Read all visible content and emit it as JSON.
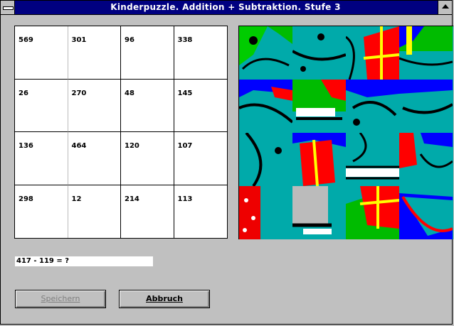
{
  "window": {
    "title": "Kinderpuzzle. Addition + Subtraktion. Stufe  3"
  },
  "grid": {
    "rows": [
      [
        "569",
        "301",
        "96",
        "338"
      ],
      [
        "26",
        "270",
        "48",
        "145"
      ],
      [
        "136",
        "464",
        "120",
        "107"
      ],
      [
        "298",
        "12",
        "214",
        "113"
      ]
    ]
  },
  "question": {
    "text": "417 - 119 = ?"
  },
  "buttons": {
    "save_label": "Speichern",
    "cancel_label": "Abbruch"
  },
  "colors": {
    "title_bar": "#000080",
    "dialog": "#c0c0c0",
    "puzzle_cyan": "#00aaaa",
    "puzzle_red": "#ff0000",
    "puzzle_blue": "#0000ff",
    "puzzle_green": "#00cc00",
    "puzzle_yellow": "#ffff00"
  }
}
